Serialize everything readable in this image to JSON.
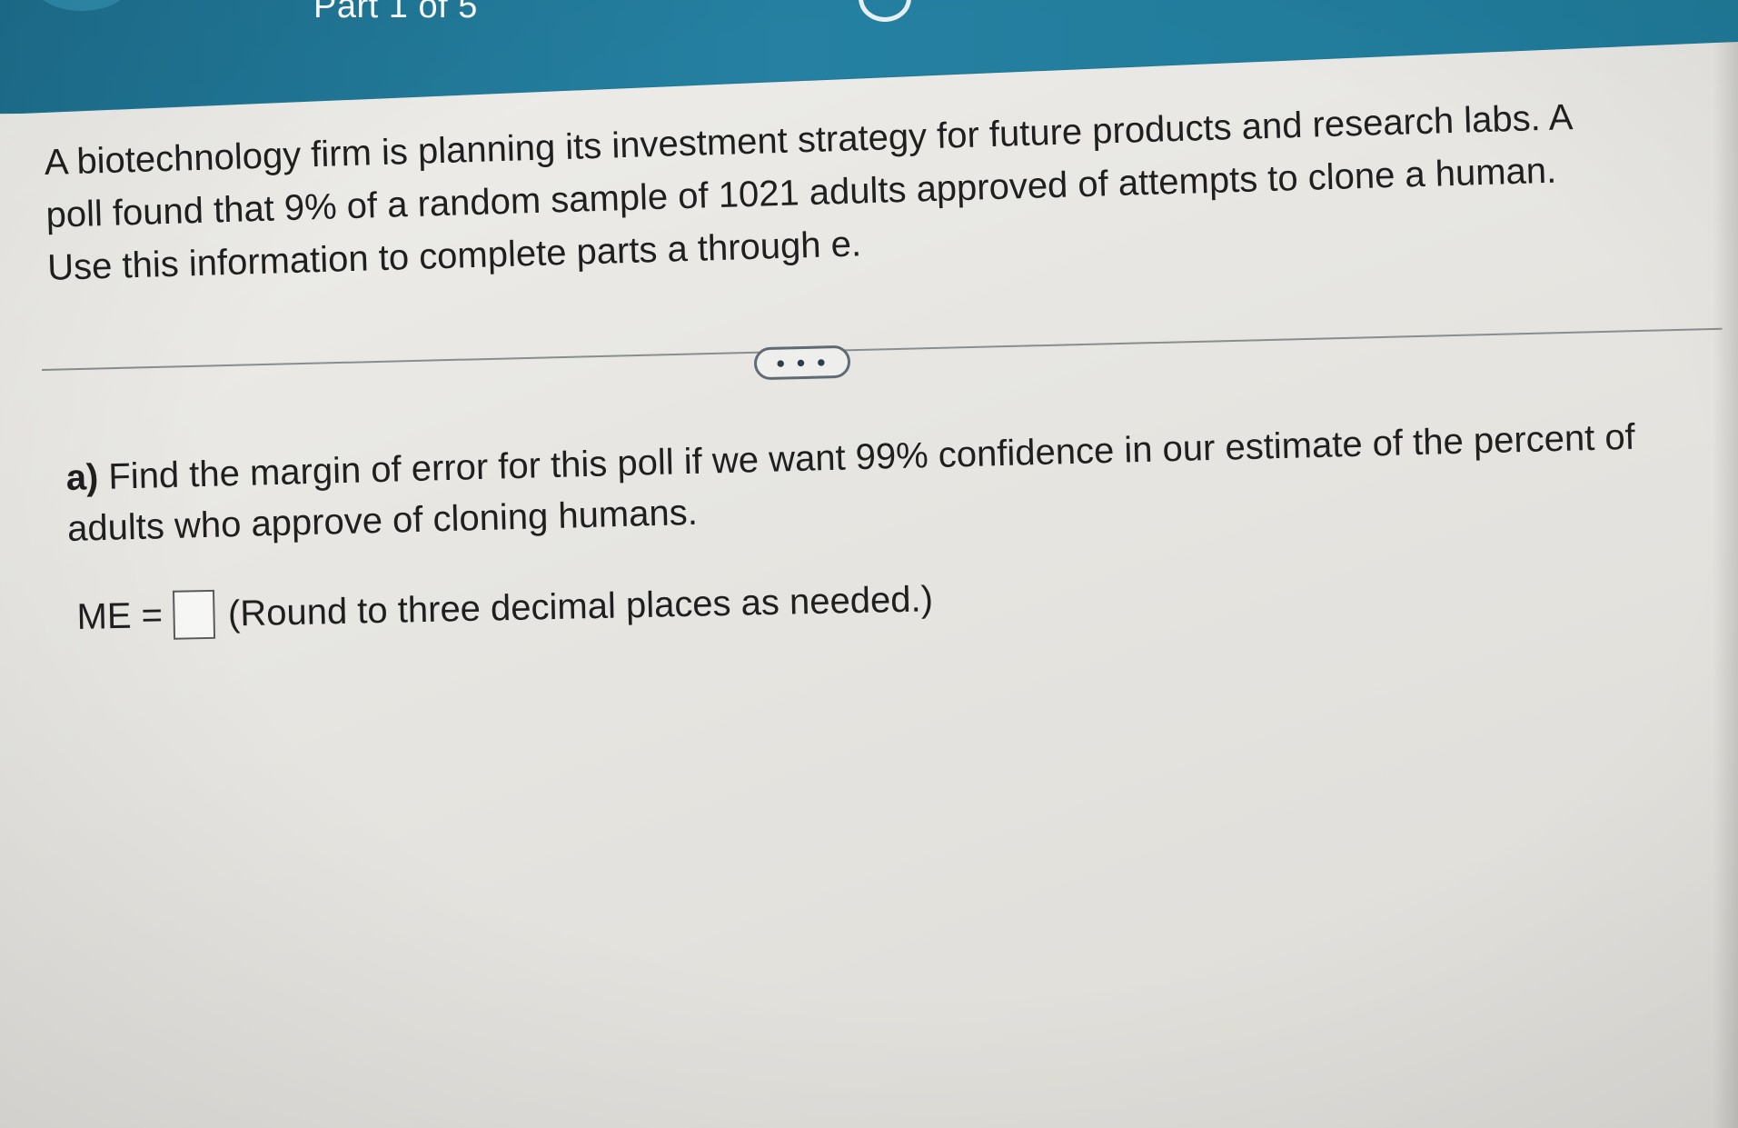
{
  "header": {
    "part_label": "Part 1 of 5",
    "accent_color": "#1f7898"
  },
  "problem": {
    "intro": "A biotechnology firm is planning its investment strategy for future products and research labs. A\npoll found that 9% of a random sample of 1021 adults approved of attempts to clone a human.\nUse this information to complete parts a through e.",
    "more_button_label": "• • •"
  },
  "question_a": {
    "part_letter": "a)",
    "text": "Find the margin of error for this poll if we want 99% confidence in our estimate of the percent of adults who approve of cloning humans.",
    "answer_label": "ME =",
    "answer_value": "",
    "hint": "(Round to three decimal places as needed.)"
  }
}
